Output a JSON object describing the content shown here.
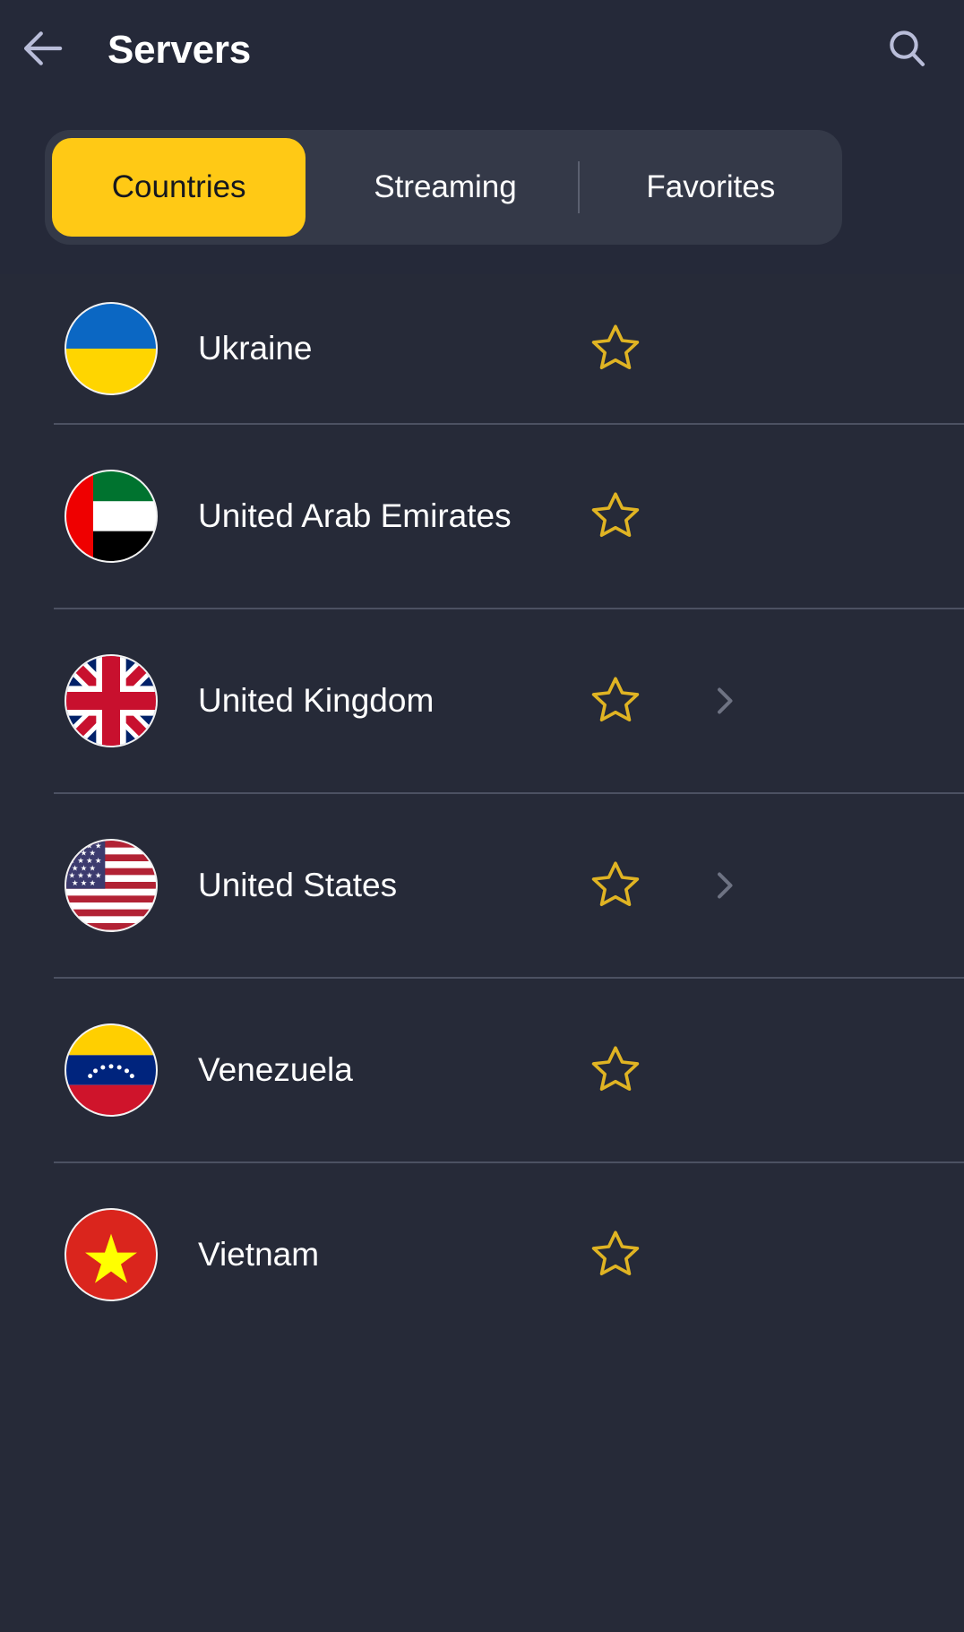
{
  "header": {
    "back_icon": "arrow-left-icon",
    "title": "Servers",
    "search_icon": "search-icon"
  },
  "tabs": {
    "items": [
      {
        "label": "Countries",
        "active": true
      },
      {
        "label": "Streaming",
        "active": false
      },
      {
        "label": "Favorites",
        "active": false
      }
    ]
  },
  "colors": {
    "background": "#262a38",
    "header_background": "#252939",
    "tabbar_background": "#343948",
    "accent_yellow": "#ffc915",
    "star_gold": "#e0b423",
    "text_primary": "#ffffff",
    "icon_lavender": "#b9bdd9",
    "chevron_grey": "#6e7383",
    "separator": "#4c5162"
  },
  "list": {
    "rows": [
      {
        "name": "Ukraine",
        "flag": "flag-ukraine",
        "star_icon": "star-outline-icon",
        "favorited": false,
        "has_chevron": false
      },
      {
        "name": "United Arab Emirates",
        "flag": "flag-united-arab-emirates",
        "star_icon": "star-outline-icon",
        "favorited": false,
        "has_chevron": false
      },
      {
        "name": "United Kingdom",
        "flag": "flag-united-kingdom",
        "star_icon": "star-outline-icon",
        "favorited": false,
        "has_chevron": true,
        "chevron_icon": "chevron-right-icon"
      },
      {
        "name": "United States",
        "flag": "flag-united-states",
        "star_icon": "star-outline-icon",
        "favorited": false,
        "has_chevron": true,
        "chevron_icon": "chevron-right-icon"
      },
      {
        "name": "Venezuela",
        "flag": "flag-venezuela",
        "star_icon": "star-outline-icon",
        "favorited": false,
        "has_chevron": false
      },
      {
        "name": "Vietnam",
        "flag": "flag-vietnam",
        "star_icon": "star-outline-icon",
        "favorited": false,
        "has_chevron": false
      }
    ]
  }
}
